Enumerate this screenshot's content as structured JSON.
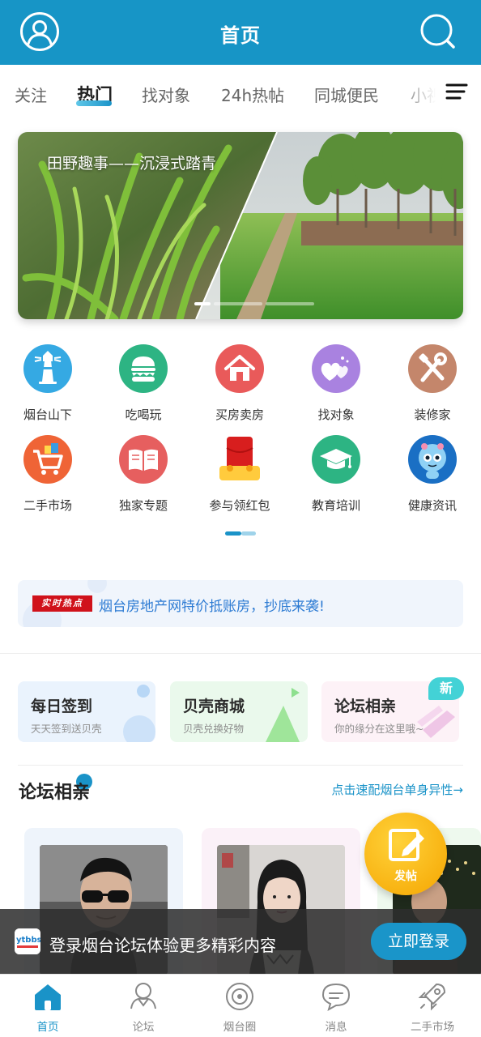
{
  "header": {
    "title": "首页",
    "user_icon": "user-icon",
    "search_icon": "search-icon"
  },
  "tabs": [
    {
      "label": "关注",
      "active": false
    },
    {
      "label": "热门",
      "active": true
    },
    {
      "label": "找对象",
      "active": false
    },
    {
      "label": "24h热帖",
      "active": false
    },
    {
      "label": "同城便民",
      "active": false
    },
    {
      "label": "小视",
      "active": false
    }
  ],
  "tabs_menu_icon": "menu-icon",
  "banner": {
    "caption": "田野趣事——沉浸式踏青",
    "slide_count": 3,
    "active_slide": 1
  },
  "grid": [
    {
      "label": "烟台山下",
      "icon": "lighthouse-icon",
      "color": "#35a9e3"
    },
    {
      "label": "吃喝玩",
      "icon": "burger-icon",
      "color": "#2db483"
    },
    {
      "label": "买房卖房",
      "icon": "house-icon",
      "color": "#e95a5a"
    },
    {
      "label": "找对象",
      "icon": "hearts-icon",
      "color": "#a982e0"
    },
    {
      "label": "装修家",
      "icon": "tools-icon",
      "color": "#c4866b"
    },
    {
      "label": "二手市场",
      "icon": "cart-icon",
      "color": "#ef6436"
    },
    {
      "label": "独家专题",
      "icon": "book-icon",
      "color": "#e65f5f"
    },
    {
      "label": "参与领红包",
      "icon": "red-packet-icon",
      "color": "#d81e1e"
    },
    {
      "label": "教育培训",
      "icon": "graduation-cap-icon",
      "color": "#2db483"
    },
    {
      "label": "健康资讯",
      "icon": "mascot-icon",
      "color": "#1a6fc4"
    }
  ],
  "hot": {
    "badge": "实时热点",
    "text": "烟台房地产网特价抵账房，抄底来袭!"
  },
  "features": [
    {
      "title": "每日签到",
      "subtitle": "天天签到送贝壳",
      "bg": "#eaf3fd"
    },
    {
      "title": "贝壳商城",
      "subtitle": "贝壳兑换好物",
      "bg": "#eaf9ec"
    },
    {
      "title": "论坛相亲",
      "subtitle": "你的缘分在这里哦~",
      "bg": "#fdf2f7"
    }
  ],
  "new_badge": "新",
  "section": {
    "title": "论坛相亲",
    "link": "点击速配烟台单身异性→"
  },
  "fab": {
    "label": "发帖",
    "icon": "edit-icon"
  },
  "login": {
    "text": "登录烟台论坛体验更多精彩内容",
    "button": "立即登录",
    "logo_text": "ytbbs"
  },
  "nav": [
    {
      "label": "首页",
      "icon": "home-icon",
      "active": true
    },
    {
      "label": "论坛",
      "icon": "forum-icon",
      "active": false
    },
    {
      "label": "烟台圈",
      "icon": "circle-icon",
      "active": false
    },
    {
      "label": "消息",
      "icon": "message-icon",
      "active": false
    },
    {
      "label": "二手市场",
      "icon": "rocket-icon",
      "active": false
    }
  ]
}
